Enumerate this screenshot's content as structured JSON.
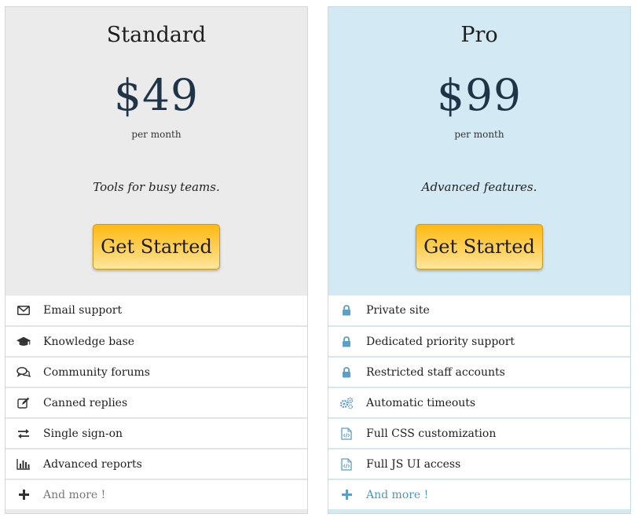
{
  "plans": [
    {
      "name": "Standard",
      "price": "$49",
      "period": "per month",
      "tagline": "Tools for busy teams.",
      "cta": "Get Started",
      "features": [
        {
          "label": "Email support",
          "icon": "envelope-icon"
        },
        {
          "label": "Knowledge base",
          "icon": "graduation-cap-icon"
        },
        {
          "label": "Community forums",
          "icon": "chat-bubbles-icon"
        },
        {
          "label": "Canned replies",
          "icon": "edit-icon"
        },
        {
          "label": "Single sign-on",
          "icon": "exchange-arrows-icon"
        },
        {
          "label": "Advanced reports",
          "icon": "bar-chart-icon"
        },
        {
          "label": "And more !",
          "icon": "plus-icon"
        }
      ]
    },
    {
      "name": "Pro",
      "price": "$99",
      "period": "per month",
      "tagline": "Advanced features.",
      "cta": "Get Started",
      "features": [
        {
          "label": "Private site",
          "icon": "lock-icon"
        },
        {
          "label": "Dedicated priority support",
          "icon": "lock-icon"
        },
        {
          "label": "Restricted staff accounts",
          "icon": "lock-icon"
        },
        {
          "label": "Automatic timeouts",
          "icon": "gears-icon"
        },
        {
          "label": "Full CSS customization",
          "icon": "code-file-icon"
        },
        {
          "label": "Full JS UI access",
          "icon": "code-file-icon"
        },
        {
          "label": "And more !",
          "icon": "plus-icon"
        }
      ]
    }
  ],
  "colors": {
    "standard_bg": "#ebebeb",
    "pro_bg": "#d3e9f3",
    "button": "#fdb912",
    "price": "#1f3447",
    "pro_icon": "#5b9fc4"
  }
}
